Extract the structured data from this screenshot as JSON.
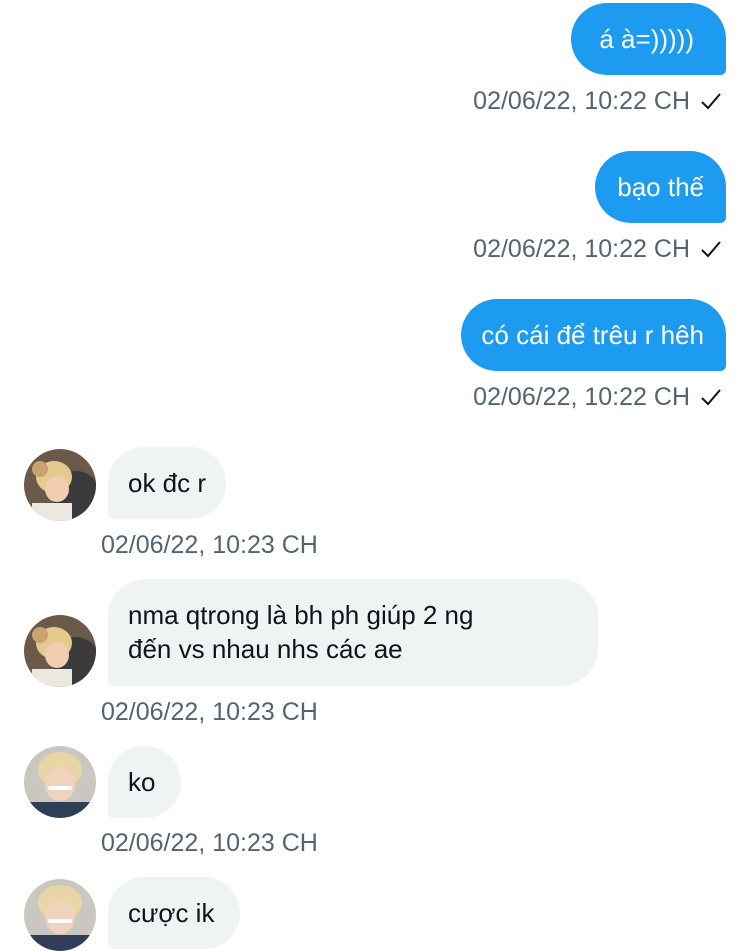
{
  "messages": [
    {
      "direction": "sent",
      "text": "á à=)))))",
      "timestamp": "02/06/22, 10:22 CH",
      "status_icon": "checkmark-icon"
    },
    {
      "direction": "sent",
      "text": "bạo thế",
      "timestamp": "02/06/22, 10:22 CH",
      "status_icon": "checkmark-icon"
    },
    {
      "direction": "sent",
      "text": "có cái để trêu r hêh",
      "timestamp": "02/06/22, 10:22 CH",
      "status_icon": "checkmark-icon"
    },
    {
      "direction": "received",
      "avatar": "avatar-a",
      "text": "ok đc r",
      "timestamp": "02/06/22, 10:23 CH"
    },
    {
      "direction": "received",
      "avatar": "avatar-a",
      "text_lines": [
        "nma qtrong là bh ph giúp 2 ng",
        "đến vs nhau nhs các ae"
      ],
      "timestamp": "02/06/22, 10:23 CH"
    },
    {
      "direction": "received",
      "avatar": "avatar-b",
      "text": "ko",
      "timestamp": "02/06/22, 10:23 CH"
    },
    {
      "direction": "received",
      "avatar": "avatar-b",
      "text": "cược ik"
    }
  ],
  "colors": {
    "sent_bubble": "#1d9bf0",
    "received_bubble": "#eff3f4",
    "timestamp": "#536471",
    "text": "#0f1419"
  }
}
